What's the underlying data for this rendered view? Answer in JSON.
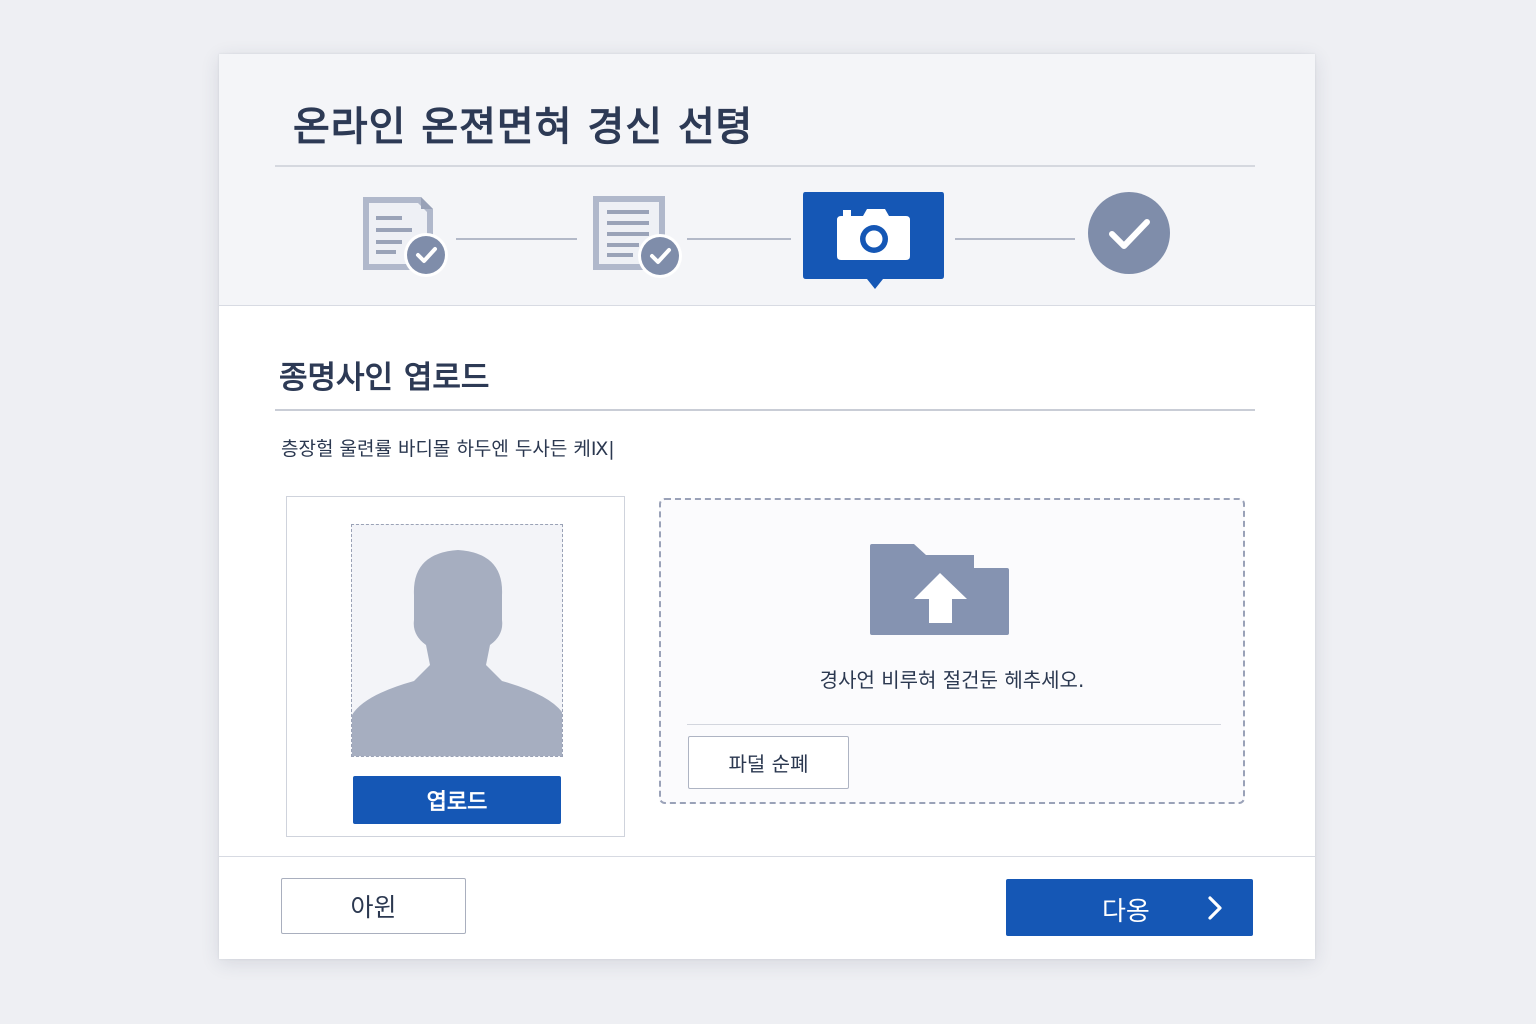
{
  "header": {
    "title": "온라인 온젼면혀 경신 선텽"
  },
  "stepper": {
    "steps": [
      {
        "icon": "document-check-icon",
        "status": "completed"
      },
      {
        "icon": "document-check-icon",
        "status": "completed"
      },
      {
        "icon": "camera-icon",
        "status": "current"
      },
      {
        "icon": "check-icon",
        "status": "pending"
      }
    ]
  },
  "section": {
    "title": "종명사인 엽로드",
    "instruction": "층장헐 울련률 바디몰 하두엔 두사든 케Ⅸ|"
  },
  "photo": {
    "placeholder_icon": "person-silhouette-icon",
    "upload_label": "엽로드"
  },
  "dropzone": {
    "icon": "folder-upload-icon",
    "text": "경사언 비루혀 절건둔 헤추세오.",
    "file_button_label": "파덜 순폐"
  },
  "footer": {
    "back_label": "아윈",
    "next_label": "다옹",
    "next_icon": "chevron-right-icon"
  },
  "colors": {
    "primary": "#1557b5",
    "completed": "#7f8daa",
    "text": "#2d3a55"
  }
}
